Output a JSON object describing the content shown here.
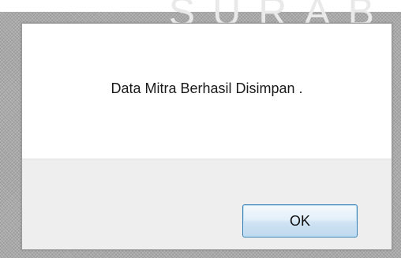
{
  "background": {
    "watermark_text": "SURAB"
  },
  "dialog": {
    "message": "Data Mitra Berhasil Disimpan .",
    "ok_label": "OK"
  },
  "colors": {
    "button_border": "#3c7fb1",
    "footer_background": "#eeeeee"
  }
}
